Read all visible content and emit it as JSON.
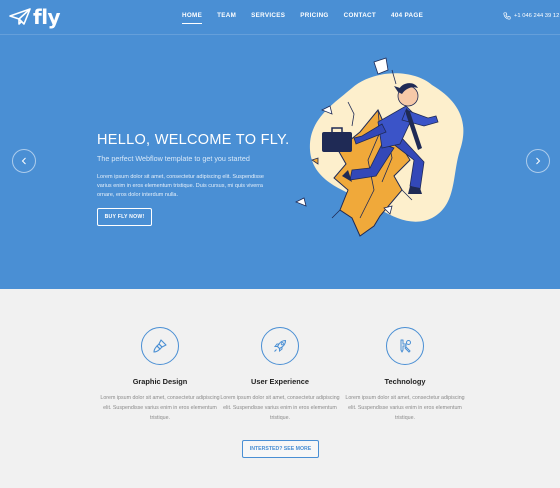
{
  "brand": {
    "name": "fly",
    "accent": "#4a8fd4"
  },
  "nav": [
    {
      "label": "HOME",
      "active": true
    },
    {
      "label": "TEAM"
    },
    {
      "label": "SERVICES"
    },
    {
      "label": "PRICING"
    },
    {
      "label": "CONTACT"
    },
    {
      "label": "404 PAGE"
    }
  ],
  "phone": {
    "icon": "phone-icon",
    "number": "+1 046 244 39 12"
  },
  "hero": {
    "title": "HELLO, WELCOME TO FLY.",
    "subtitle": "The perfect Webflow template to get you started",
    "description": "Lorem ipsum dolor sit amet, consectetur adipiscing elit. Suspendisse varius enim in eros elementum tristique. Duis cursus, mi quis viverra ornare, eros dolor interdum nulla.",
    "button": "BUY FLY NOW!",
    "prev_icon": "chevron-left-icon",
    "next_icon": "chevron-right-icon"
  },
  "features": [
    {
      "icon": "paint-brush-icon",
      "title": "Graphic Design",
      "desc": "Lorem ipsum dolor sit amet, consectetur adipiscing elit. Suspendisse varius enim in eros elementum tristique."
    },
    {
      "icon": "rocket-icon",
      "title": "User Experience",
      "desc": "Lorem ipsum dolor sit amet, consectetur adipiscing elit. Suspendisse varius enim in eros elementum tristique."
    },
    {
      "icon": "tools-icon",
      "title": "Technology",
      "desc": "Lorem ipsum dolor sit amet, consectetur adipiscing elit. Suspendisse varius enim in eros elementum tristique."
    }
  ],
  "cta": "INTERSTED? SEE MORE"
}
